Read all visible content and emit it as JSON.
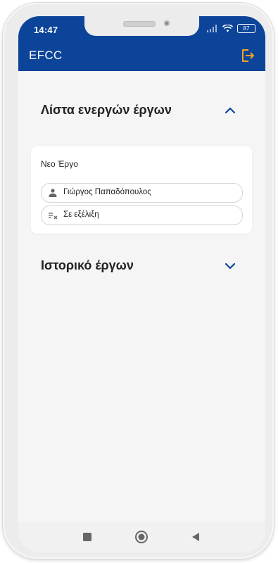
{
  "status_bar": {
    "time": "14:47",
    "battery": "87"
  },
  "app_bar": {
    "title": "EFCC",
    "logout_icon": "logout-icon",
    "accent_color": "#f5a623"
  },
  "active_projects": {
    "title": "Λίστα ενεργών έργων",
    "expanded": true,
    "projects": [
      {
        "name": "Νεο Έργο",
        "person": "Γιώργος Παπαδόπουλος",
        "status": "Σε εξέλιξη"
      }
    ]
  },
  "history": {
    "title": "Ιστορικό έργων",
    "expanded": false
  },
  "colors": {
    "primary": "#0c449a",
    "background": "#f5f5f5",
    "card": "#ffffff"
  },
  "nav_bar": {
    "items": [
      "square-icon",
      "circle-icon",
      "back-triangle-icon"
    ]
  }
}
